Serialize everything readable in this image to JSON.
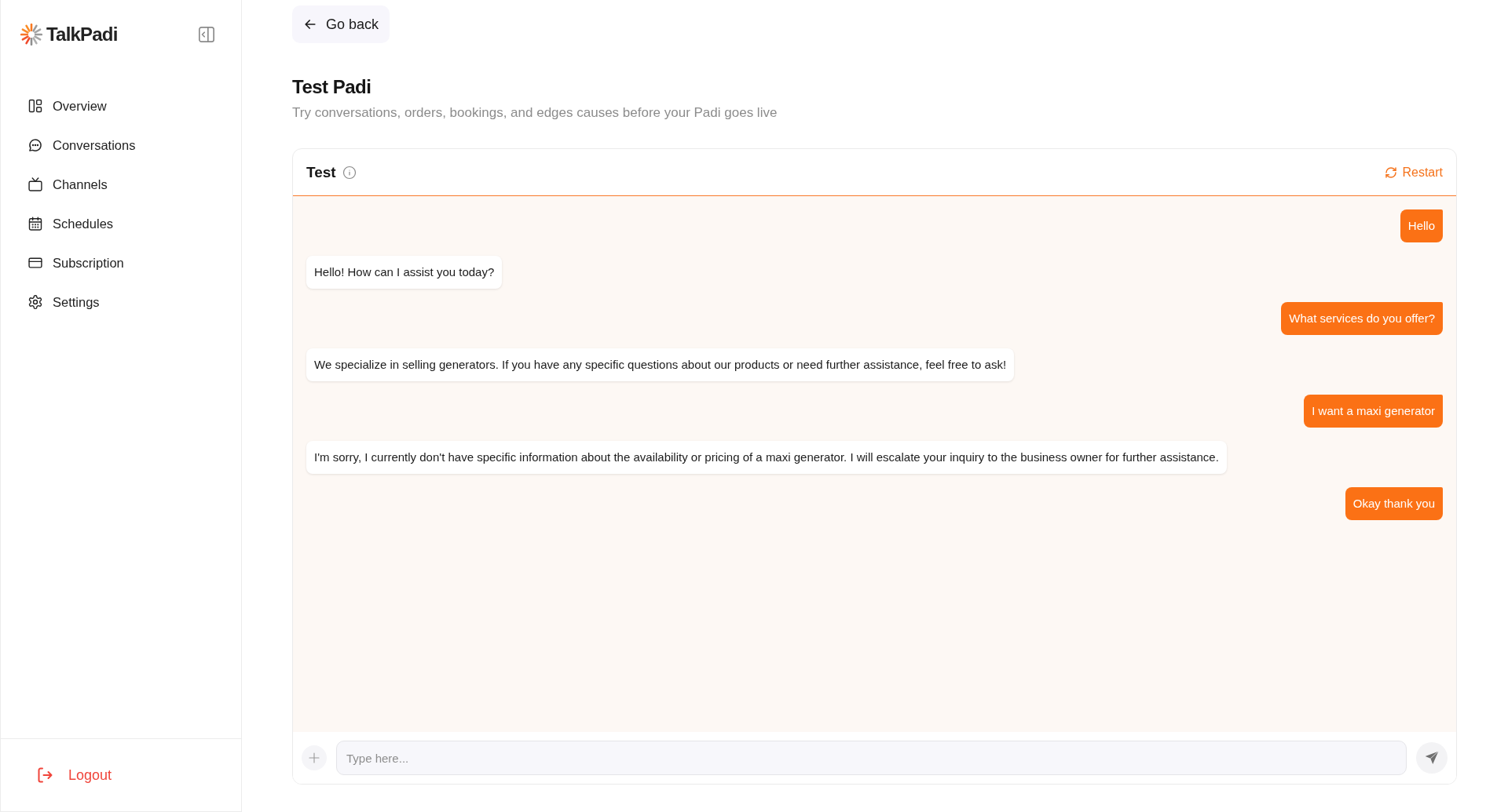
{
  "sidebar": {
    "brand": "TalkPadi",
    "items": [
      {
        "label": "Overview",
        "selected": false
      },
      {
        "label": "Conversations",
        "selected": false
      },
      {
        "label": "Channels",
        "selected": false
      },
      {
        "label": "Schedules",
        "selected": false
      },
      {
        "label": "Subscription",
        "selected": false
      },
      {
        "label": "Settings",
        "selected": false
      }
    ],
    "logout": "Logout"
  },
  "header": {
    "back_button": "Go back",
    "title": "Test Padi",
    "subtitle": "Try conversations, orders, bookings, and edges causes before your Padi goes live"
  },
  "chat": {
    "title": "Test",
    "restart": "Restart",
    "messages": [
      {
        "kind": "user",
        "text": "Hello"
      },
      {
        "kind": "bot",
        "text": "Hello! How can I assist you today?"
      },
      {
        "kind": "user",
        "text": "What services do you offer?"
      },
      {
        "kind": "bot",
        "text": "We specialize in selling generators. If you have any specific questions about our products or need further assistance, feel free to ask!"
      },
      {
        "kind": "user",
        "text": "I want a maxi generator"
      },
      {
        "kind": "bot",
        "text": "I'm sorry, I currently don't have specific information about the availability or pricing of a maxi generator. I will escalate your inquiry to the business owner for further assistance."
      },
      {
        "kind": "user",
        "text": "Okay thank you"
      }
    ],
    "composer": {
      "placeholder": "Type here..."
    }
  }
}
